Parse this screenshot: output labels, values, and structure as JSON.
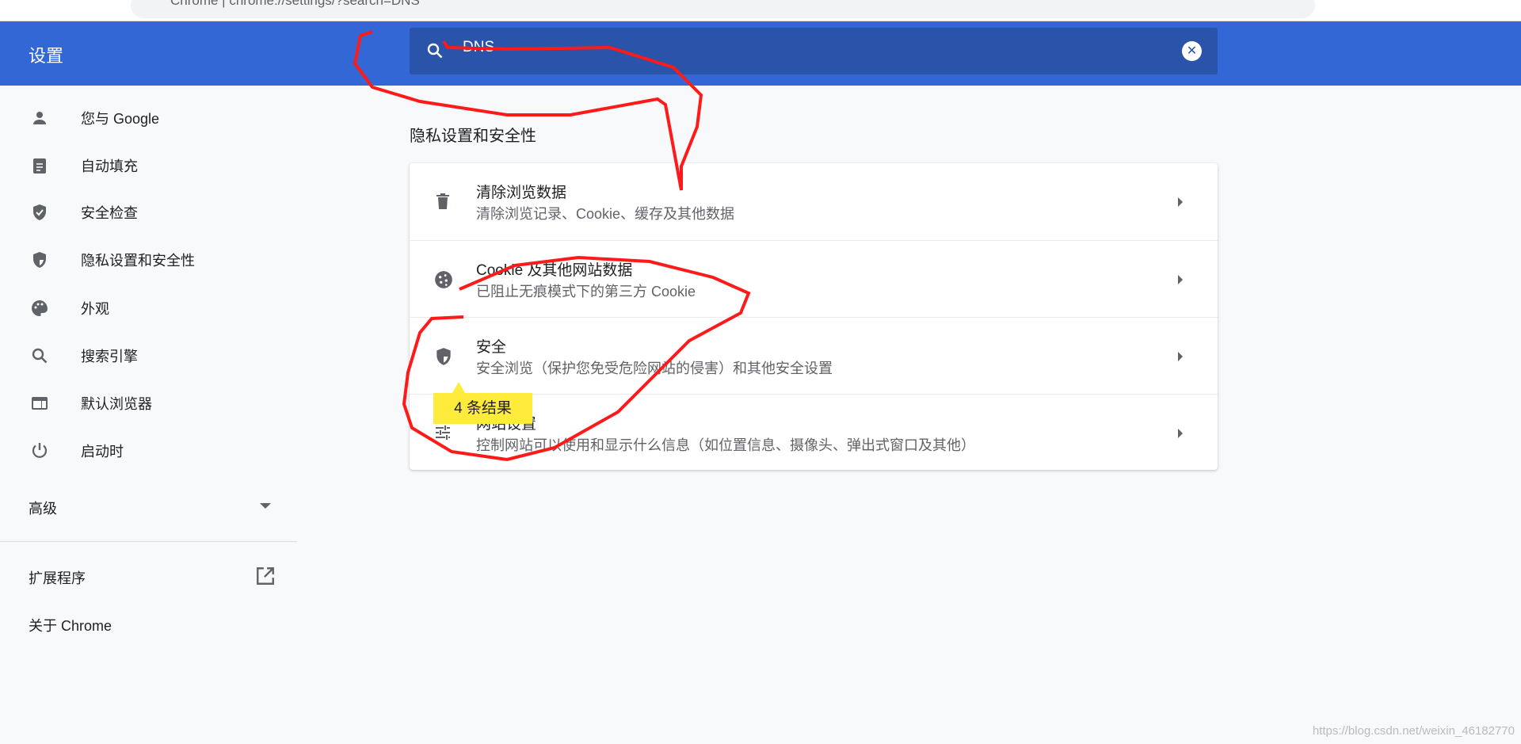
{
  "browser": {
    "url": "Chrome | chrome://settings/?search=DNS"
  },
  "header": {
    "title": "设置",
    "search_value": "DNS",
    "clear_icon": "clear-icon"
  },
  "sidebar": {
    "items": [
      {
        "label": "您与 Google",
        "icon": "person-icon"
      },
      {
        "label": "自动填充",
        "icon": "clipboard-icon"
      },
      {
        "label": "安全检查",
        "icon": "shield-check-icon"
      },
      {
        "label": "隐私设置和安全性",
        "icon": "shield-half-icon"
      },
      {
        "label": "外观",
        "icon": "palette-icon"
      },
      {
        "label": "搜索引擎",
        "icon": "search-icon"
      },
      {
        "label": "默认浏览器",
        "icon": "browser-icon"
      },
      {
        "label": "启动时",
        "icon": "power-icon"
      }
    ],
    "advanced": "高级",
    "extensions": "扩展程序",
    "about": "关于 Chrome"
  },
  "main": {
    "section_title": "隐私设置和安全性",
    "rows": [
      {
        "title": "清除浏览数据",
        "subtitle": "清除浏览记录、Cookie、缓存及其他数据",
        "icon": "trash-icon"
      },
      {
        "title": "Cookie 及其他网站数据",
        "subtitle": "已阻止无痕模式下的第三方 Cookie",
        "icon": "cookie-icon"
      },
      {
        "title": "安全",
        "subtitle": "安全浏览（保护您免受危险网站的侵害）和其他安全设置",
        "icon": "shield-half-icon"
      },
      {
        "title": "网站设置",
        "subtitle": "控制网站可以使用和显示什么信息（如位置信息、摄像头、弹出式窗口及其他）",
        "icon": "tune-icon"
      }
    ]
  },
  "tooltip": "4 条结果",
  "watermark": "https://blog.csdn.net/weixin_46182770",
  "colors": {
    "header": "#3367d6",
    "search": "#2a53aa",
    "annotation": "#ff1a1a",
    "tooltip": "#ffeb3b"
  }
}
